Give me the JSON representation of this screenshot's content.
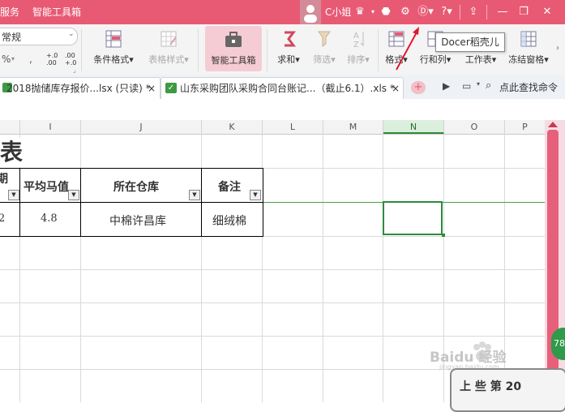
{
  "titlebar": {
    "menu": [
      "服务",
      "智能工具箱"
    ],
    "user_name": "C小姐",
    "help_label": "?"
  },
  "ribbon": {
    "number_format": "常规",
    "percent": "%",
    "thousands": "000",
    "comma": ",",
    "increase_decimal": "+.0 .00",
    "decrease_decimal": ".00 +.0",
    "conditional_format": "条件格式",
    "table_style": "表格样式",
    "smart_toolbox": "智能工具箱",
    "sum": "求和",
    "filter": "筛选",
    "sort": "排序",
    "format": "格式",
    "row_col": "行和列",
    "worksheet": "工作表",
    "freeze": "冻结窗格"
  },
  "tooltip": "Docer稻壳儿",
  "tabs": [
    {
      "label": "2018抛储库存报价...lsx (只读) *",
      "close": "×"
    },
    {
      "label": "山东采购团队采购合同台账记...（截止6.1）.xls *",
      "close": "×"
    }
  ],
  "tabbar": {
    "add": "+",
    "find_command": "点此查找命令"
  },
  "columns": [
    "I",
    "J",
    "K",
    "L",
    "M",
    "N",
    "O",
    "P"
  ],
  "selected_column": "N",
  "sheet": {
    "title_fragment": "表",
    "headers": [
      "平均马值",
      "所在仓库",
      "备注"
    ],
    "left_fragment_header": "期",
    "row": [
      "4.8",
      "中棉许昌库",
      "细绒棉"
    ],
    "left_fragment_value": "2"
  },
  "badge": "78",
  "watermark": "Baidu 经验",
  "watermark_sub": "jingyan.baidu.com",
  "corner_fragment": "上 些 第 20",
  "colors": {
    "titlebar": "#e85a74",
    "accent": "#e85a74",
    "selection": "#2e8b3c"
  }
}
